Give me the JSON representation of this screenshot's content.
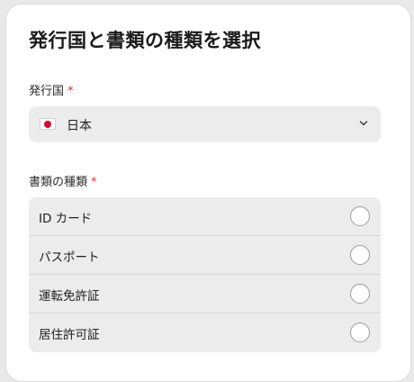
{
  "title": "発行国と書類の種類を選択",
  "country": {
    "label": "発行国",
    "required_mark": "*",
    "selected": "日本",
    "flag_icon": "japan-flag-icon"
  },
  "document_type": {
    "label": "書類の種類",
    "required_mark": "*",
    "options": [
      {
        "label": "ID カード",
        "selected": false
      },
      {
        "label": "パスポート",
        "selected": false
      },
      {
        "label": "運転免許証",
        "selected": false
      },
      {
        "label": "居住許可証",
        "selected": false
      }
    ]
  },
  "colors": {
    "required": "#e0312b",
    "field_background": "#ececec",
    "flag_red": "#c8102e"
  }
}
